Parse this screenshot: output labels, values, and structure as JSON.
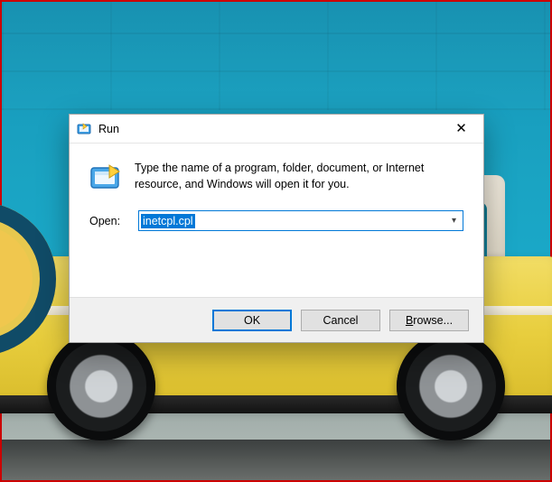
{
  "dialog": {
    "title": "Run",
    "description": "Type the name of a program, folder, document, or Internet resource, and Windows will open it for you.",
    "open_label": "Open:",
    "input_value": "inetcpl.cpl",
    "icon_name": "run-icon",
    "small_icon_name": "run-icon-small",
    "dropdown_icon": "chevron-down-icon",
    "close_icon": "close-icon"
  },
  "buttons": {
    "ok": "OK",
    "cancel": "Cancel",
    "browse": "Browse..."
  },
  "colors": {
    "accent": "#0078d7",
    "window_bg": "#ffffff",
    "button_panel_bg": "#f0f0f0"
  }
}
